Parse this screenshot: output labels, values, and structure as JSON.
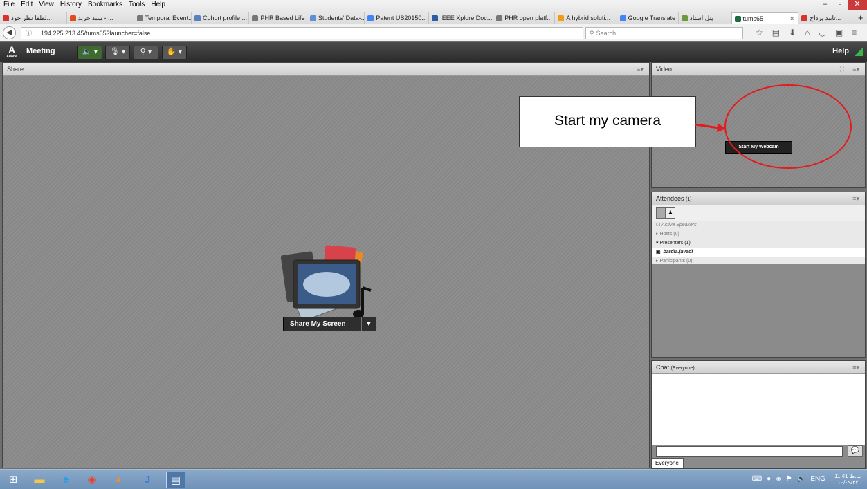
{
  "browser": {
    "menu": [
      "File",
      "Edit",
      "View",
      "History",
      "Bookmarks",
      "Tools",
      "Help"
    ],
    "tabs": [
      {
        "label": "لطفا نظر خود...",
        "color": "#d7322c"
      },
      {
        "label": "سید خرید - ...",
        "color": "#e04a1d"
      },
      {
        "label": "Temporal Event...",
        "color": "#777777"
      },
      {
        "label": "Cohort profile ...",
        "color": "#5a7fc1"
      },
      {
        "label": "PHR Based Life ...",
        "color": "#777777"
      },
      {
        "label": "Students' Data-...",
        "color": "#5f8fd6"
      },
      {
        "label": "Patent US20150...",
        "color": "#4285f4"
      },
      {
        "label": "IEEE Xplore Doc...",
        "color": "#2a5ca8"
      },
      {
        "label": "PHR open platf...",
        "color": "#777777"
      },
      {
        "label": "A hybrid soluti...",
        "color": "#f39c12"
      },
      {
        "label": "Google Translate",
        "color": "#4285f4"
      },
      {
        "label": "پنل استاد",
        "color": "#6a9a3a"
      },
      {
        "label": "tums65",
        "color": "#1d6b3a"
      },
      {
        "label": "تایید پرداخ...",
        "color": "#d7322c"
      }
    ],
    "active_tab_close": "×",
    "new_tab": "+",
    "url": "194.225.213.45/tums65?launcher=false",
    "search_placeholder": "Search"
  },
  "toolbar": {
    "logo_text": "A",
    "logo_sub": "Adobe",
    "meeting_label": "Meeting",
    "help_label": "Help"
  },
  "share_pod": {
    "title": "Share",
    "button_label": "Share My Screen"
  },
  "video_pod": {
    "title": "Video",
    "webcam_button": "Start My Webcam"
  },
  "attendees_pod": {
    "title": "Attendees",
    "count": "(1)",
    "active_speakers": "Active Speakers",
    "hosts": "Hosts (0)",
    "presenters": "Presenters (1)",
    "presenter_name": "bardia.javadi",
    "participants": "Participants (0)"
  },
  "chat_pod": {
    "title": "Chat",
    "subtitle": "(Everyone)",
    "tab_label": "Everyone"
  },
  "annotation": {
    "text": "Start my camera",
    "color": "#e31b1b"
  },
  "taskbar": {
    "lang": "ENG",
    "time": "11:41 ب.ظ",
    "date": "۱۰/۰۹/۲۲"
  }
}
